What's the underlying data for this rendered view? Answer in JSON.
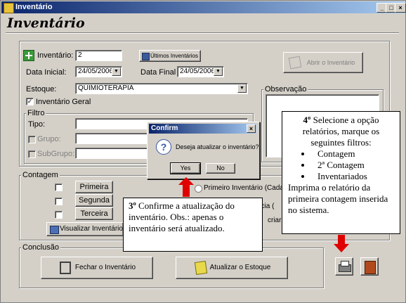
{
  "window": {
    "title": "Inventário",
    "min": "_",
    "max": "□",
    "close": "×"
  },
  "heading": "Inventário",
  "form": {
    "inventario_label": "Inventário:",
    "inventario_value": "2",
    "ultimos_button": "Últimos Inventários",
    "abrir_button": "Abrir o Inventário",
    "data_inicial_label": "Data Inicial:",
    "data_inicial_value": "24/05/2006",
    "data_final_label": "Data Final",
    "data_final_value": "24/05/2006",
    "estoque_label": "Estoque:",
    "estoque_value": "QUIMIOTERAPIA",
    "inventario_geral_label": "Inventário Geral",
    "observacao_label": "Observação"
  },
  "filtro": {
    "title": "Filtro",
    "tipo_label": "Tipo:",
    "grupo_label": "Grupo:",
    "subgrupo_label": "SubGrupo:"
  },
  "contagem": {
    "title": "Contagem",
    "primeira": "Primeira",
    "segunda": "Segunda",
    "terceira": "Terceira",
    "visualizar": "Visualizar Inventário",
    "radio_label": "Primeiro Inventário (Cadast",
    "partial_text_1": "ncia (",
    "partial_text_2": "criar"
  },
  "conclusao": {
    "title": "Conclusão",
    "fechar": "Fechar o Inventário",
    "atualizar": "Atualizar o Estoque"
  },
  "dialog": {
    "title": "Confirm",
    "close": "×",
    "message": "Deseja atualizar o inventário?.",
    "yes": "Yes",
    "no": "No"
  },
  "callout3": {
    "number": "3º",
    "text": " Confirme a atualização do inventário. Obs.: apenas o inventário será atualizado."
  },
  "callout4": {
    "number": "4º",
    "intro": " Selecione a opção relatórios, marque os seguintes filtros:",
    "items": [
      "Contagem",
      "2ª Contagem",
      "Inventariados"
    ],
    "outro": "Imprima o relatório da primeira contagem inserida no sistema."
  },
  "colors": {
    "arrow": "#e00000",
    "title_start": "#0a246a",
    "title_end": "#a6caf0",
    "face": "#d4d0c8"
  }
}
